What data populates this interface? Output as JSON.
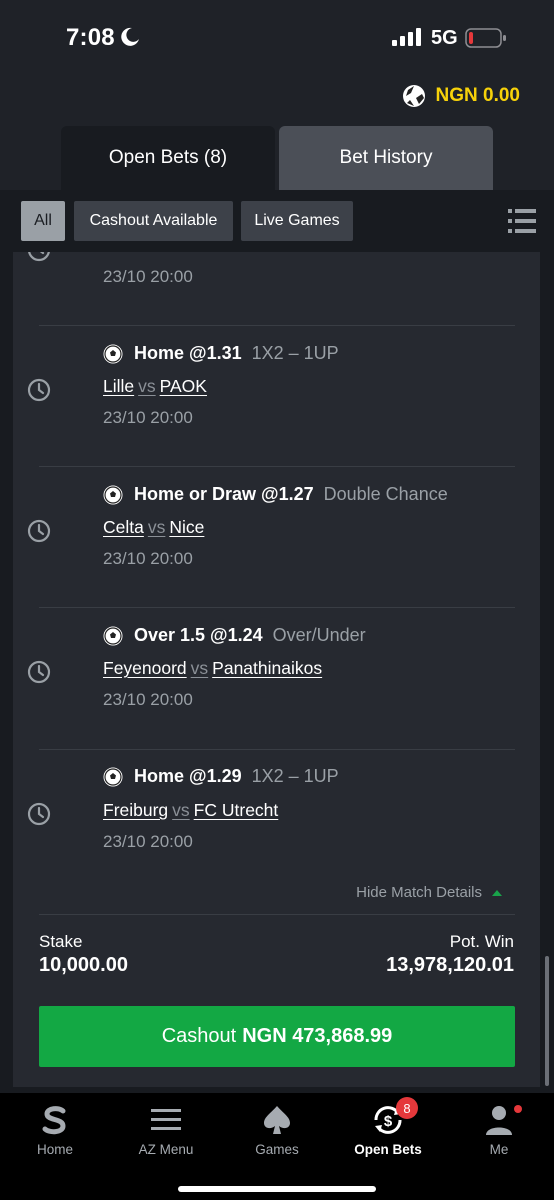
{
  "status_bar": {
    "time": "7:08",
    "network": "5G"
  },
  "account": {
    "balance": "NGN 0.00"
  },
  "tabs": [
    {
      "label": "Open Bets (8)",
      "active": true
    },
    {
      "label": "Bet History",
      "active": false
    }
  ],
  "filters": [
    {
      "label": "All",
      "active": true
    },
    {
      "label": "Cashout Available",
      "active": false
    },
    {
      "label": "Live Games",
      "active": false
    }
  ],
  "bets": [
    {
      "pick": "",
      "market": "",
      "home": "",
      "away": "",
      "vs": "",
      "date": "23/10 20:00"
    },
    {
      "pick": "Home @1.31",
      "market": "1X2  –  1UP",
      "home": "Lille",
      "vs": "vs",
      "away": "PAOK",
      "date": "23/10 20:00"
    },
    {
      "pick": "Home or Draw @1.27",
      "market": "Double Chance",
      "home": "Celta",
      "vs": "vs",
      "away": "Nice",
      "date": "23/10 20:00"
    },
    {
      "pick": "Over 1.5 @1.24",
      "market": "Over/Under",
      "home": "Feyenoord",
      "vs": "vs",
      "away": "Panathinaikos",
      "date": "23/10 20:00"
    },
    {
      "pick": "Home @1.29",
      "market": "1X2  –  1UP",
      "home": "Freiburg",
      "vs": "vs",
      "away": "FC Utrecht",
      "date": "23/10 20:00"
    }
  ],
  "details_toggle": "Hide Match Details",
  "summary": {
    "stake_label": "Stake",
    "stake_value": "10,000.00",
    "pot_win_label": "Pot. Win",
    "pot_win_value": "13,978,120.01"
  },
  "cashout": {
    "label": "Cashout",
    "amount": "NGN 473,868.99"
  },
  "bottom_nav": [
    {
      "label": "Home",
      "icon": "sporty-logo-icon"
    },
    {
      "label": "AZ Menu",
      "icon": "menu-icon"
    },
    {
      "label": "Games",
      "icon": "spade-icon"
    },
    {
      "label": "Open Bets",
      "icon": "open-bets-icon",
      "badge": "8",
      "active": true
    },
    {
      "label": "Me",
      "icon": "person-icon"
    }
  ],
  "colors": {
    "accent_green": "#13a844",
    "balance_yellow": "#f7d20a",
    "badge_red": "#e5383b"
  }
}
